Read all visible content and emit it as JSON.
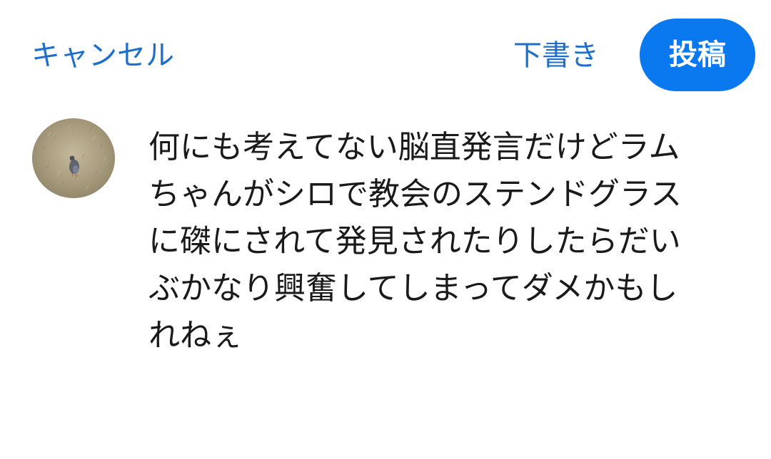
{
  "header": {
    "cancel_label": "キャンセル",
    "draft_label": "下書き",
    "post_label": "投稿"
  },
  "composer": {
    "lines": [
      "何にも考えてない脳直発言だけどラム",
      "ちゃんがシロで教会のステンドグラス",
      "に磔にされて発見されたりしたらだい",
      "ぶかなり興奮してしまってダメかもし",
      "れねぇ"
    ]
  },
  "colors": {
    "accent": "#1d6fc9",
    "post_button_bg": "#0a78ee",
    "text": "#1a1a1a",
    "background": "#ffffff"
  },
  "icons": {
    "avatar": "pigeon-on-grass-photo"
  }
}
